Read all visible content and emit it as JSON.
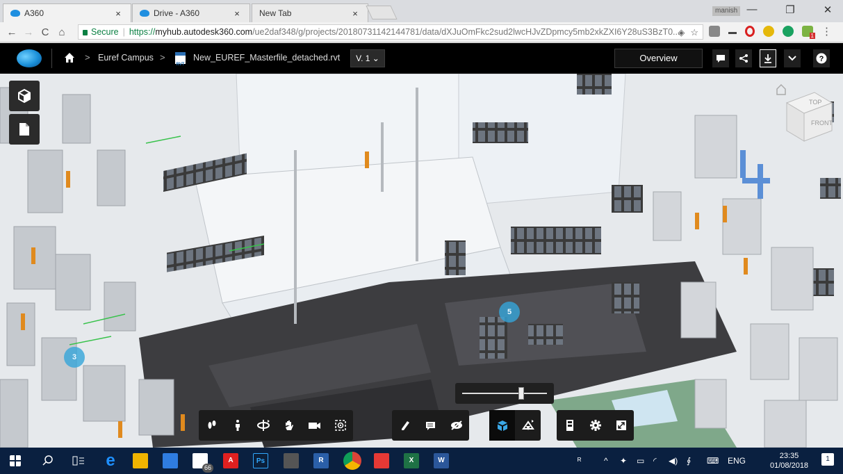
{
  "browser": {
    "tabs": [
      {
        "title": "A360",
        "close": "×",
        "active": true
      },
      {
        "title": "Drive - A360",
        "close": "×",
        "active": false
      },
      {
        "title": "New Tab",
        "close": "×",
        "active": false
      }
    ],
    "profile_name": "manish",
    "window_controls": {
      "minimize": "—",
      "maximize": "❐",
      "close": "✕"
    },
    "nav": {
      "back": "←",
      "forward": "→",
      "reload": "C",
      "home": "⌂"
    },
    "secure_label": "Secure",
    "url_scheme": "https://",
    "url_host": "myhub.autodesk360.com",
    "url_path": "/ue2daf348/g/projects/20180731142144781/data/dXJuOmFkc2sud2lwcHJvZDpmcy5mb2xkZXI6Y28uS3BzT0...",
    "menu_icon": "⋮",
    "extension_badge": "1"
  },
  "header": {
    "breadcrumb_project": "Euref Campus",
    "breadcrumb_separator": ">",
    "file_name": "New_EUREF_Masterfile_detached.rvt",
    "file_type_badge": "RVT",
    "version_label": "V. 1 ⌄",
    "overview_label": "Overview",
    "colors": {
      "background": "#000000",
      "accent": "#1a8fd8"
    }
  },
  "viewer": {
    "markers": [
      {
        "label": "5"
      },
      {
        "label": "3"
      }
    ],
    "viewcube": {
      "top_label": "TOP",
      "front_label": "FRONT"
    },
    "sectioning_slider_value": 0.7
  },
  "toolbar": {
    "groups": [
      [
        "first-person-icon",
        "walk-icon",
        "orbit-icon",
        "pan-icon",
        "camera-icon",
        "fit-to-view-icon"
      ],
      [
        "markup-icon",
        "annotation-icon",
        "hide-icon"
      ],
      [
        "explode-icon",
        "section-icon"
      ],
      [
        "model-browser-icon",
        "settings-icon",
        "fullscreen-icon"
      ]
    ],
    "active_tool": "explode-icon"
  },
  "taskbar": {
    "mail_badge": "66",
    "tray_language": "ENG",
    "clock_time": "23:35",
    "clock_date": "01/08/2018",
    "notification_badge": "1",
    "apps": [
      "start",
      "search",
      "task-view",
      "edge",
      "file-explorer",
      "store",
      "mail",
      "acrobat",
      "photoshop",
      "calculator",
      "revit",
      "chrome",
      "acrobat-reader",
      "excel",
      "word"
    ]
  }
}
